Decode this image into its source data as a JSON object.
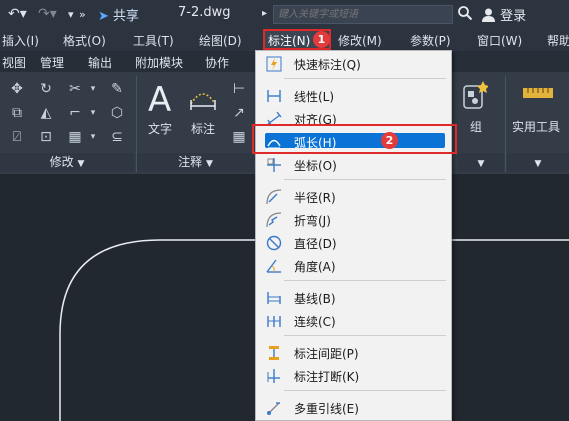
{
  "titlebar": {
    "share_label": "共享",
    "filename": "7-2.dwg",
    "search_placeholder": "键入关键字或短语",
    "login_label": "登录"
  },
  "menubar": {
    "items": [
      "插入(I)",
      "格式(O)",
      "工具(T)",
      "绘图(D)",
      "标注(N)",
      "修改(M)",
      "参数(P)",
      "窗口(W)",
      "帮助"
    ]
  },
  "ribbon_tabs": [
    "视图",
    "管理",
    "输出",
    "附加模块",
    "协作"
  ],
  "ribbon": {
    "panels": {
      "modify": "修改",
      "annotate": "注释",
      "group": "组",
      "utilities": "实用工具"
    },
    "text_label": "文字",
    "dimension_label": "标注"
  },
  "dropdown": {
    "items": [
      {
        "label": "快速标注(Q)",
        "icon": "quick-dimension-icon"
      },
      {
        "label": "线性(L)",
        "icon": "linear-icon"
      },
      {
        "label": "对齐(G)",
        "icon": "aligned-icon"
      },
      {
        "label": "弧长(H)",
        "icon": "arc-length-icon"
      },
      {
        "label": "坐标(O)",
        "icon": "ordinate-icon"
      },
      {
        "label": "半径(R)",
        "icon": "radius-icon"
      },
      {
        "label": "折弯(J)",
        "icon": "jogged-icon"
      },
      {
        "label": "直径(D)",
        "icon": "diameter-icon"
      },
      {
        "label": "角度(A)",
        "icon": "angular-icon"
      },
      {
        "label": "基线(B)",
        "icon": "baseline-icon"
      },
      {
        "label": "连续(C)",
        "icon": "continue-icon"
      },
      {
        "label": "标注间距(P)",
        "icon": "dimspace-icon"
      },
      {
        "label": "标注打断(K)",
        "icon": "dimbreak-icon"
      },
      {
        "label": "多重引线(E)",
        "icon": "multileader-icon"
      }
    ]
  },
  "annotations": {
    "badge_1": "1",
    "badge_2": "2"
  },
  "colors": {
    "highlight": "#0b73d6",
    "annotation_red": "#e02a2a"
  }
}
